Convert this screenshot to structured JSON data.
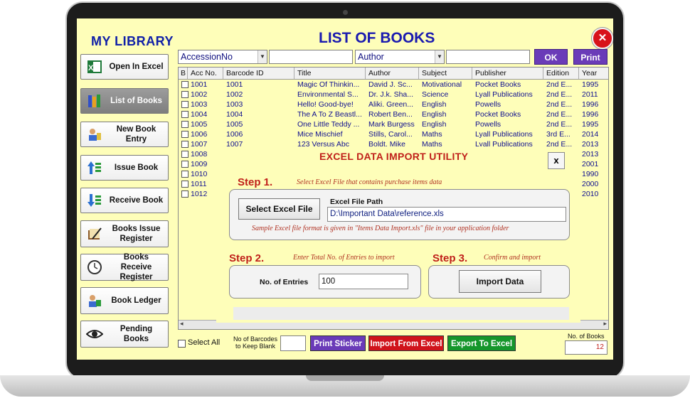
{
  "app": {
    "sidebar_title": "MY LIBRARY",
    "main_title": "LIST OF BOOKS",
    "close_label": "✕"
  },
  "sidebar": {
    "items": [
      {
        "label": "Open In Excel",
        "icon": "excel-icon"
      },
      {
        "label": "List of Books",
        "icon": "books-list-icon",
        "active": true
      },
      {
        "label": "New Book Entry",
        "icon": "new-entry-icon"
      },
      {
        "label": "Issue Book",
        "icon": "issue-book-icon"
      },
      {
        "label": "Receive Book",
        "icon": "receive-book-icon"
      },
      {
        "label": "Books Issue Register",
        "icon": "issue-register-icon"
      },
      {
        "label": "Books Receive Register",
        "icon": "clock-icon"
      },
      {
        "label": "Book Ledger",
        "icon": "ledger-icon"
      },
      {
        "label": "Pending Books",
        "icon": "eye-icon"
      }
    ]
  },
  "filter": {
    "field1": "AccessionNo",
    "value1": "",
    "field2": "Author",
    "value2": "",
    "ok_label": "OK",
    "print_label": "Print"
  },
  "table": {
    "columns": [
      "B",
      "Acc No.",
      "Barcode ID",
      "Title",
      "Author",
      "Subject",
      "Publisher",
      "Edition",
      "Year"
    ],
    "rows": [
      [
        "1001",
        "1001",
        "Magic Of Thinkin...",
        "David J. Sc...",
        "Motivational",
        "Pocket Books",
        "2nd E...",
        "1995"
      ],
      [
        "1002",
        "1002",
        "Environmental S...",
        "Dr. J.k. Sha...",
        "Science",
        "Lyall Publications",
        "2nd E...",
        "2011"
      ],
      [
        "1003",
        "1003",
        "Hello! Good-bye!",
        "Aliki. Green...",
        "English",
        "Powells",
        "2nd E...",
        "1996"
      ],
      [
        "1004",
        "1004",
        "The A To Z Beastl...",
        "Robert Ben...",
        "English",
        "Pocket Books",
        "2nd E...",
        "1996"
      ],
      [
        "1005",
        "1005",
        "One Little Teddy ...",
        "Mark Burgess",
        "English",
        "Powells",
        "2nd E...",
        "1995"
      ],
      [
        "1006",
        "1006",
        "Mice Mischief",
        "Stills, Carol...",
        "Maths",
        "Lyall Publications",
        "3rd E...",
        "2014"
      ],
      [
        "1007",
        "1007",
        "123 Versus Abc",
        "Boldt, Mike",
        "Maths",
        "Lyall Publications",
        "2nd E...",
        "2013"
      ],
      [
        "1008",
        "",
        "",
        "",
        "",
        "",
        "",
        "2013"
      ],
      [
        "1009",
        "",
        "",
        "",
        "",
        "",
        "",
        "2001"
      ],
      [
        "1010",
        "",
        "",
        "",
        "",
        "",
        "",
        "1990"
      ],
      [
        "1011",
        "",
        "",
        "",
        "",
        "",
        "",
        "2000"
      ],
      [
        "1012",
        "",
        "",
        "",
        "",
        "",
        "",
        "2010"
      ]
    ]
  },
  "dialog": {
    "title": "EXCEL DATA IMPORT UTILITY",
    "close_label": "x",
    "step1_label": "Step 1.",
    "step1_desc": "Select Excel File that contains purchase items data",
    "select_file_label": "Select Excel File",
    "file_path_label": "Excel File Path",
    "file_path_value": "D:\\Important Data\\reference.xls",
    "sample_note": "Sample Excel file format is given in \"Items Data Import.xls\" file in your application folder",
    "step2_label": "Step 2.",
    "step2_desc": "Enter Total No. of Entries to import",
    "entries_label": "No. of Entries",
    "entries_value": "100",
    "step3_label": "Step 3.",
    "step3_desc": "Confirm and import",
    "import_label": "Import Data"
  },
  "bottom": {
    "select_all_label": "Select All",
    "barcodes_blank_label_1": "No of Barcodes",
    "barcodes_blank_label_2": "to Keep Blank",
    "barcodes_blank_value": "",
    "print_sticker_label": "Print Sticker",
    "import_excel_label": "Import From Excel",
    "export_excel_label": "Export To Excel",
    "no_of_books_label": "No. of Books",
    "no_of_books_value": "12"
  },
  "colors": {
    "screen_bg": "#fefeb9",
    "title_blue": "#1a1ab0",
    "step_red": "#c0201a",
    "purple": "#6a3bb8",
    "red": "#d0131b",
    "green": "#15962b"
  }
}
